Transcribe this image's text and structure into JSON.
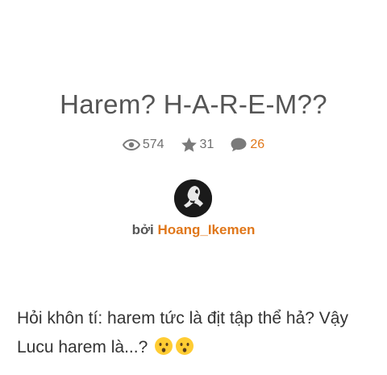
{
  "story": {
    "title": "Harem? H-A-R-E-M??",
    "stats": {
      "views": "574",
      "votes": "31",
      "comments": "26"
    },
    "byline_prefix": "bởi",
    "author": "Hoang_Ikemen",
    "description": "Hỏi khôn tí: harem tức là địt tập thể hả? Vậy Lucu harem là...?",
    "description_emojis": [
      "hushed-face-emoji",
      "hushed-face-emoji"
    ]
  },
  "colors": {
    "accent": "#e0771a",
    "text": "#333333",
    "muted": "#6f6f6f"
  }
}
